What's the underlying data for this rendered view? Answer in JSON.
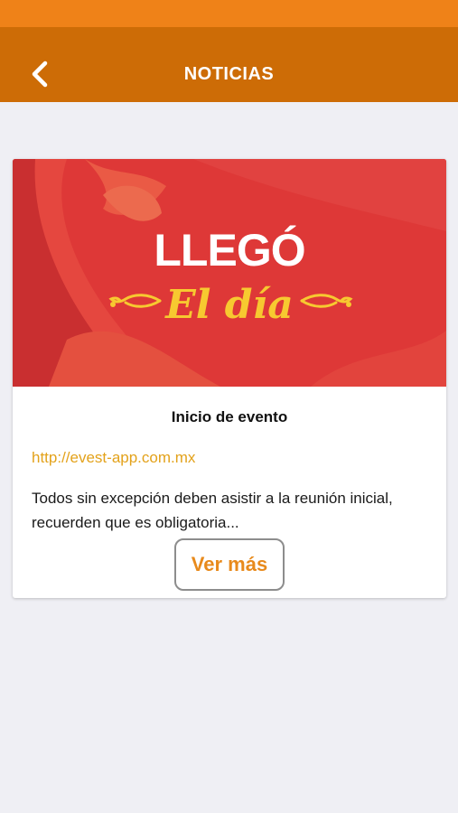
{
  "header": {
    "title": "NOTICIAS",
    "back_icon": "chevron-left-icon"
  },
  "news": [
    {
      "banner": {
        "title": "LLEGÓ",
        "script": "El día"
      },
      "title": "Inicio de evento",
      "link": "http://evest-app.com.mx",
      "body": "Todos sin excepción deben asistir a la reunión inicial, recuerden que es obligatoria...",
      "more_label": "Ver más"
    }
  ],
  "colors": {
    "status_bar": "#ef8218",
    "nav_bar": "#cd6c06",
    "banner_red": "#de3837",
    "banner_gold": "#f7c930",
    "link": "#e3a21b",
    "accent": "#e88a1c",
    "background": "#efeff4"
  }
}
